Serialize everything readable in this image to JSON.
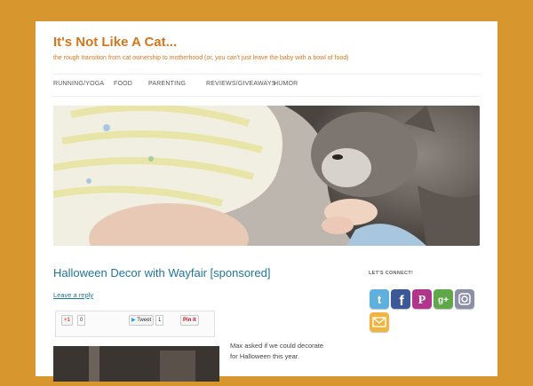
{
  "site": {
    "title": "It's Not Like A Cat...",
    "description": "the rough transition from cat ownership to motherhood (or, you can't just leave the baby with a bowl of food)"
  },
  "nav": {
    "items": [
      {
        "label": "RUNNING/YOGA"
      },
      {
        "label": "FOOD"
      },
      {
        "label": "PARENTING"
      },
      {
        "label": "REVIEWS/GIVEAWAYS"
      },
      {
        "label": "HUMOR"
      }
    ]
  },
  "post": {
    "title": "Halloween Decor with Wayfair [sponsored]",
    "leave_reply": "Leave a reply",
    "share": {
      "gplus_label": "+1",
      "gplus_count": "0",
      "tweet_label": "Tweet",
      "tweet_count": "1",
      "pin_label": "Pin it"
    },
    "excerpt_lines": [
      "Max asked if we could decorate",
      "for Halloween this year."
    ]
  },
  "sidebar": {
    "widget_title": "LET'S CONNECT!",
    "icons": [
      "twitter-icon",
      "facebook-icon",
      "pinterest-icon",
      "google-plus-icon",
      "instagram-icon",
      "email-icon"
    ]
  },
  "colors": {
    "background": "#d8962e",
    "accent": "#d4761c",
    "link": "#21759b"
  }
}
